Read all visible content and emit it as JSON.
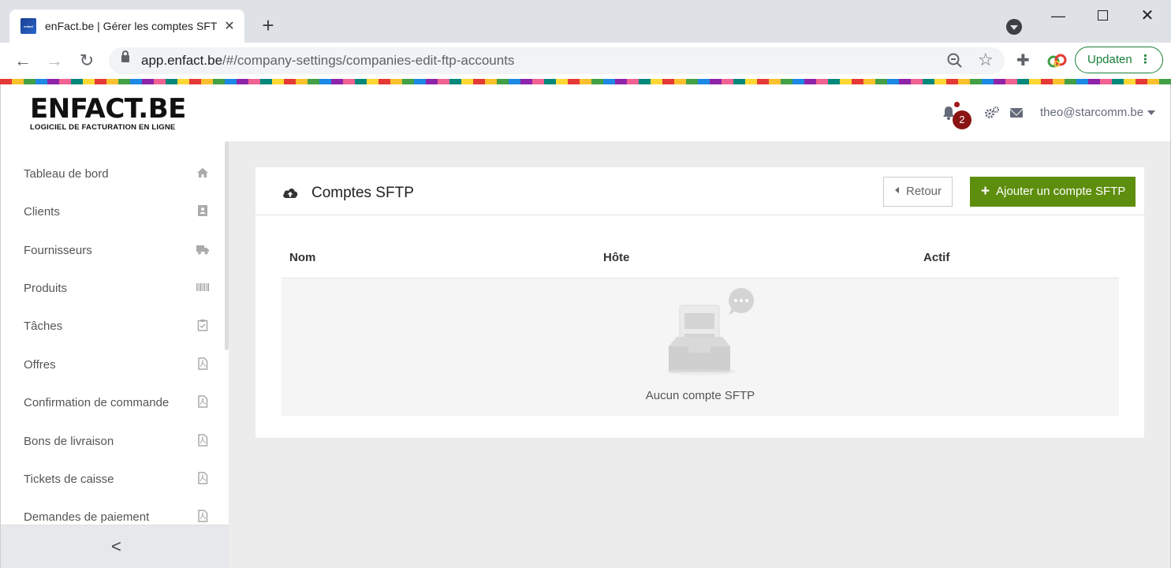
{
  "browser": {
    "tab_title": "enFact.be | Gérer les comptes SFTP",
    "url_host": "app.enfact.be",
    "url_path": "/#/company-settings/companies-edit-ftp-accounts",
    "update_label": "Updaten"
  },
  "header": {
    "logo_main": "ENFACT.BE",
    "logo_sub": "LOGICIEL DE FACTURATION EN LIGNE",
    "notification_count": "2",
    "user_email": "theo@starcomm.be"
  },
  "sidebar": {
    "items": [
      {
        "label": "Tableau de bord",
        "icon": "home-icon"
      },
      {
        "label": "Clients",
        "icon": "address-book-icon"
      },
      {
        "label": "Fournisseurs",
        "icon": "truck-icon"
      },
      {
        "label": "Produits",
        "icon": "barcode-icon"
      },
      {
        "label": "Tâches",
        "icon": "clipboard-check-icon"
      },
      {
        "label": "Offres",
        "icon": "pdf-file-icon"
      },
      {
        "label": "Confirmation de commande",
        "icon": "pdf-file-icon"
      },
      {
        "label": "Bons de livraison",
        "icon": "pdf-file-icon"
      },
      {
        "label": "Tickets de caisse",
        "icon": "pdf-file-icon"
      },
      {
        "label": "Demandes de paiement",
        "icon": "pdf-file-icon"
      }
    ],
    "collapse_label": "<"
  },
  "panel": {
    "title": "Comptes SFTP",
    "back_label": "Retour",
    "add_label": "Ajouter un compte SFTP",
    "columns": [
      "Nom",
      "Hôte",
      "Actif"
    ],
    "empty_text": "Aucun compte SFTP"
  },
  "colors": {
    "accent_green": "#5e8e0e",
    "badge_red": "#8a1414",
    "update_green": "#188038"
  }
}
